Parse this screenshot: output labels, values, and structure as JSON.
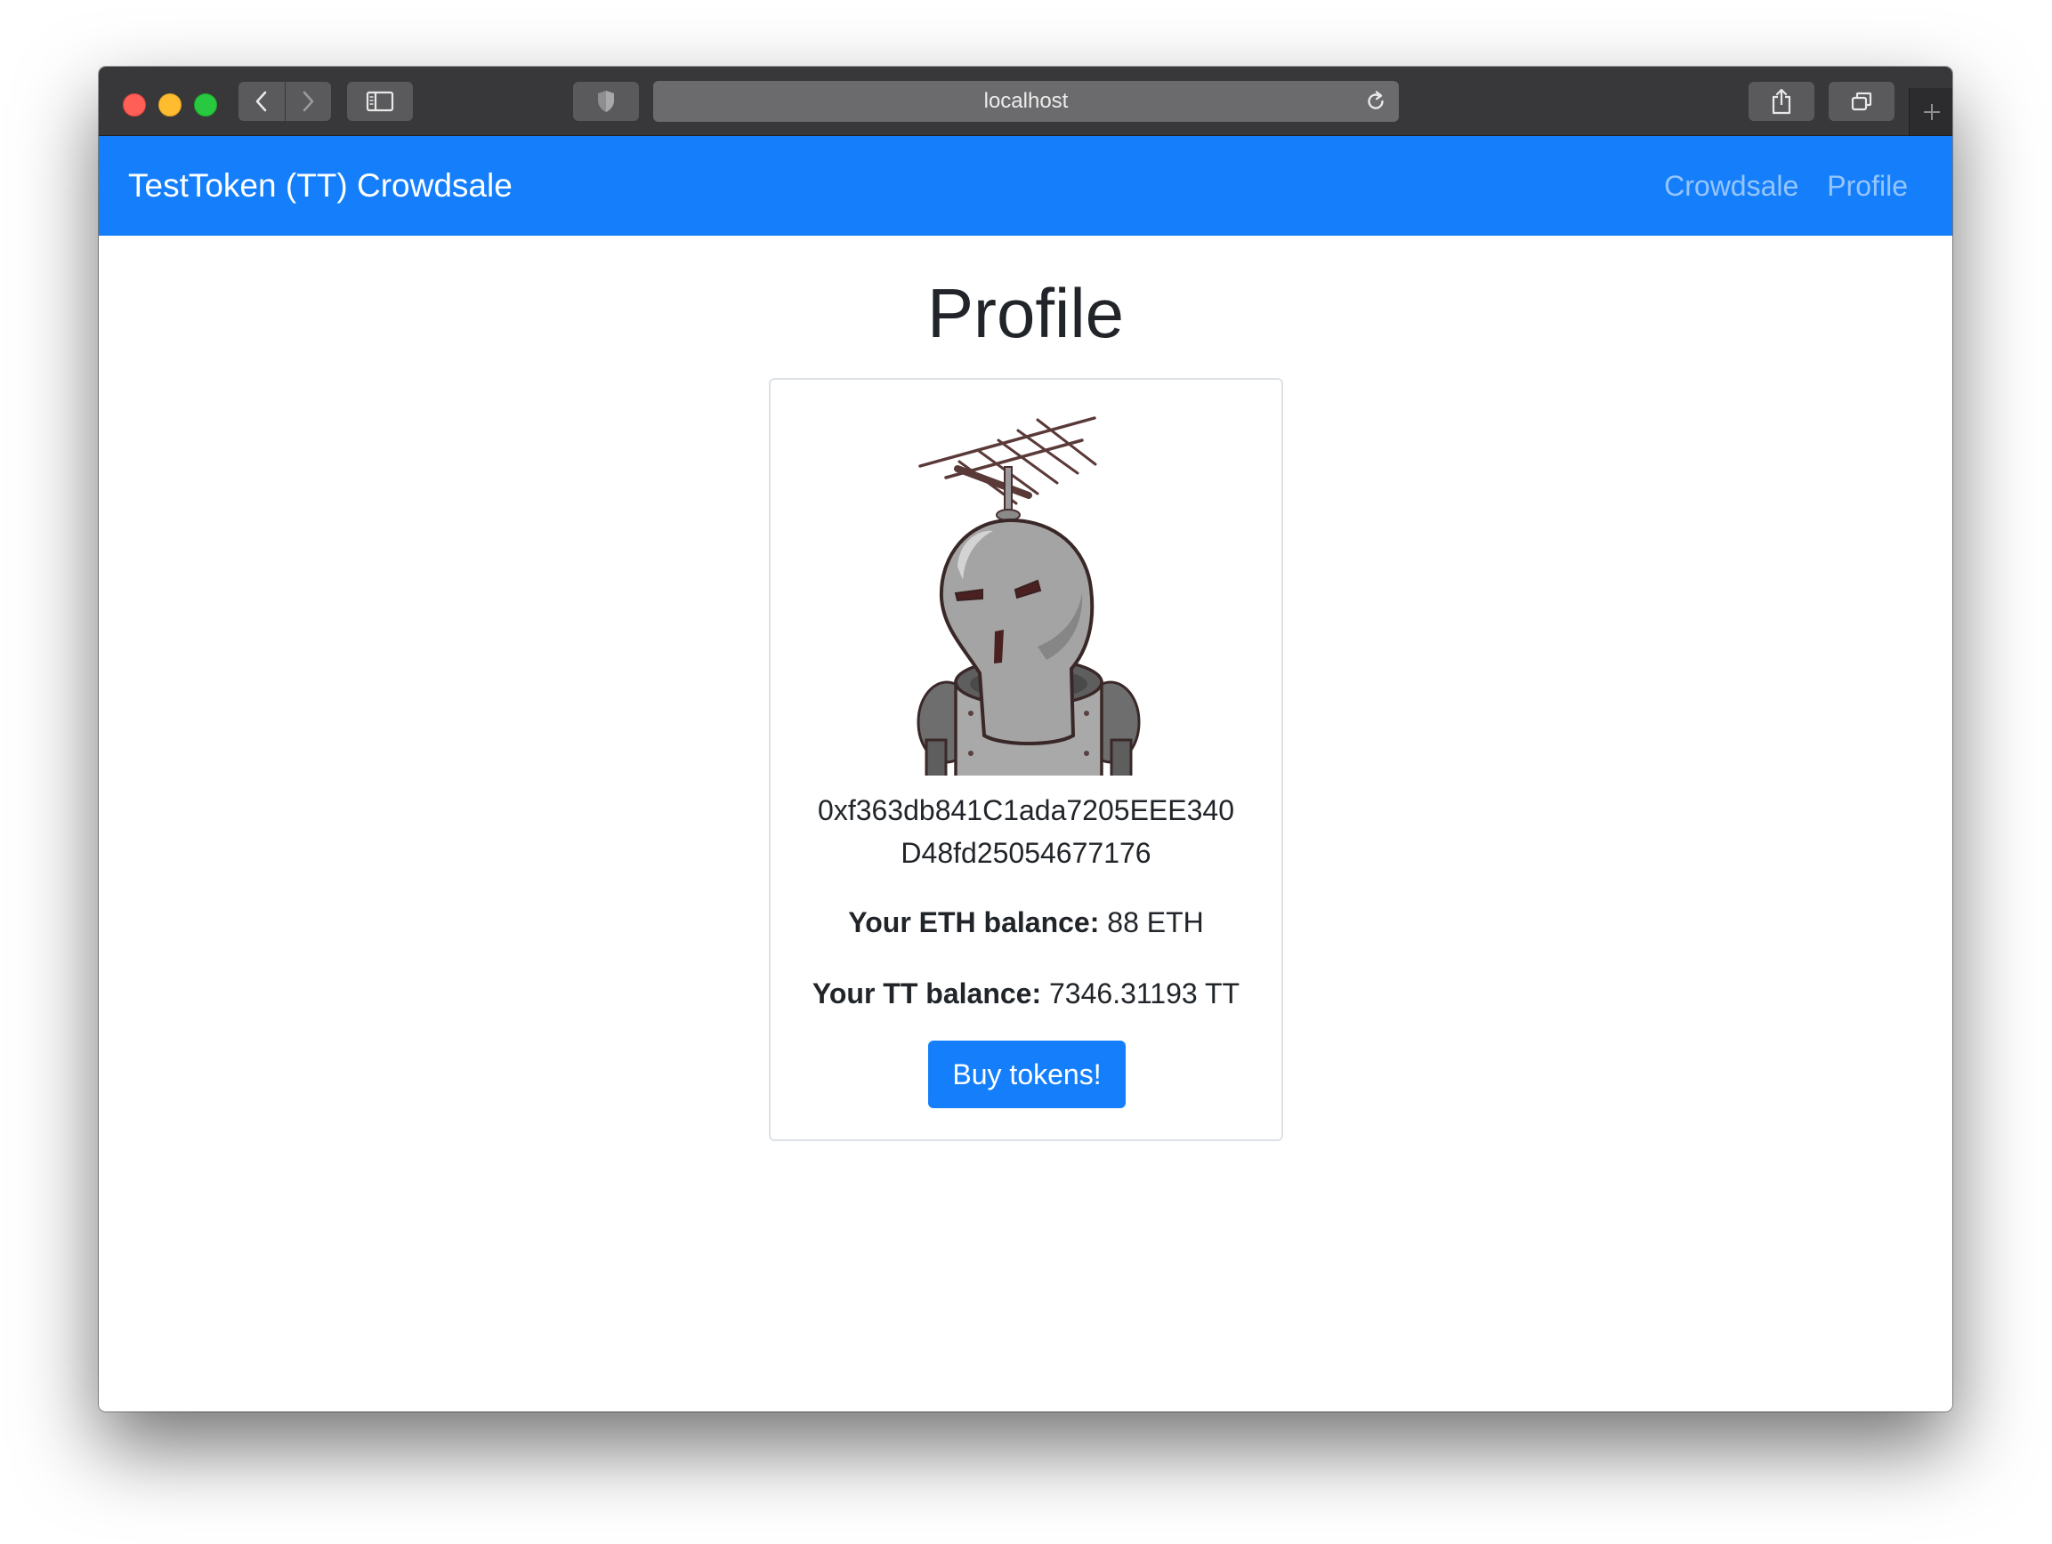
{
  "browser": {
    "url": "localhost"
  },
  "navbar": {
    "brand": "TestToken (TT) Crowdsale",
    "links": [
      "Crowdsale",
      "Profile"
    ]
  },
  "profile": {
    "title": "Profile",
    "address_line1": "0xf363db841C1ada7205EEE340",
    "address_line2": "D48fd25054677176",
    "eth_label": "Your ETH balance:",
    "eth_value": "88 ETH",
    "tt_label": "Your TT balance:",
    "tt_value": "7346.31193 TT",
    "buy_button": "Buy tokens!"
  },
  "colors": {
    "primary": "#157ffb",
    "text": "#212529",
    "titlebar": "#38383a"
  },
  "icons": [
    "back-icon",
    "forward-icon",
    "sidebar-icon",
    "shield-icon",
    "reload-icon",
    "share-icon",
    "tabs-icon",
    "plus-icon",
    "robot-avatar"
  ]
}
